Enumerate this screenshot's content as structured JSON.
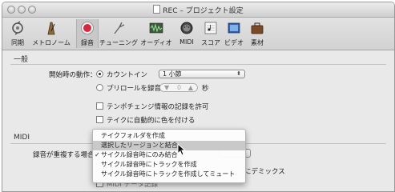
{
  "window": {
    "title": "REC – プロジェクト設定"
  },
  "toolbar": {
    "items": [
      {
        "label": "同期",
        "icon": "sync-icon"
      },
      {
        "label": "メトロノーム",
        "icon": "metronome-icon"
      },
      {
        "label": "録音",
        "icon": "record-icon",
        "selected": true
      },
      {
        "label": "チューニング",
        "icon": "tuning-fork-icon"
      },
      {
        "label": "オーディオ",
        "icon": "audio-waveform-icon"
      },
      {
        "label": "MIDI",
        "icon": "midi-port-icon"
      },
      {
        "label": "スコア",
        "icon": "score-icon"
      },
      {
        "label": "ビデオ",
        "icon": "video-icon"
      },
      {
        "label": "素材",
        "icon": "briefcase-icon"
      }
    ]
  },
  "general": {
    "section_label": "一般",
    "start_action_label": "開始時の動作：",
    "count_in_label": "カウントイン",
    "count_in_value": "1 小節",
    "preroll_label": "プリロールを録音",
    "preroll_value": "0",
    "preroll_unit": "秒",
    "tempo_check_label": "テンポチェンジ情報の記録を許可",
    "color_check_label": "テイクに自動的に色を付ける"
  },
  "midi": {
    "section_label": "MIDI",
    "overlap_label": "録音が重複する場合",
    "behind_menu_partial": "にデミックス",
    "behind_menu_row": "MIDI データ記録"
  },
  "menu": {
    "items": [
      {
        "label": "テイクフォルダを作成",
        "checked": false,
        "highlighted": false
      },
      {
        "label": "選択したリージョンと結合",
        "checked": false,
        "highlighted": true
      },
      {
        "label": "サイクル録音時にのみ結合",
        "checked": true,
        "highlighted": false
      },
      {
        "label": "サイクル録音時にトラックを作成",
        "checked": false,
        "highlighted": false
      },
      {
        "label": "サイクル録音時にトラックを作成してミュート",
        "checked": false,
        "highlighted": false
      }
    ],
    "check_glyph": "✓"
  },
  "colors": {
    "record_red": "#d6283e",
    "highlight": "#c9c9c9"
  }
}
